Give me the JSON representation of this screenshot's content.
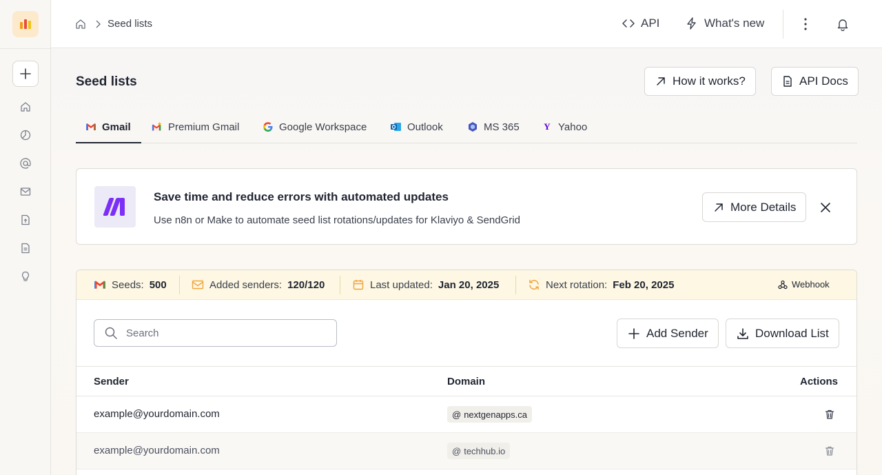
{
  "breadcrumb": {
    "current": "Seed lists"
  },
  "header": {
    "api_label": "API",
    "whats_new_label": "What's new"
  },
  "page": {
    "title": "Seed lists",
    "how_it_works_label": "How it works?",
    "api_docs_label": "API Docs"
  },
  "tabs": [
    {
      "label": "Gmail",
      "icon": "gmail-icon"
    },
    {
      "label": "Premium Gmail",
      "icon": "gmail-icon"
    },
    {
      "label": "Google Workspace",
      "icon": "google-icon"
    },
    {
      "label": "Outlook",
      "icon": "outlook-icon"
    },
    {
      "label": "MS 365",
      "icon": "ms365-icon"
    },
    {
      "label": "Yahoo",
      "icon": "yahoo-icon"
    }
  ],
  "banner": {
    "title": "Save time and reduce errors with automated updates",
    "subtitle": "Use n8n or Make to automate seed list rotations/updates for Klaviyo & SendGrid",
    "button_label": "More Details"
  },
  "stats": {
    "seeds_label": "Seeds:",
    "seeds_value": "500",
    "senders_label": "Added senders:",
    "senders_value": "120/120",
    "updated_label": "Last updated:",
    "updated_value": "Jan 20, 2025",
    "rotation_label": "Next rotation:",
    "rotation_value": "Feb 20, 2025",
    "webhook_label": "Webhook"
  },
  "search": {
    "placeholder": "Search"
  },
  "actions": {
    "add_sender_label": "Add Sender",
    "download_label": "Download List"
  },
  "table": {
    "columns": [
      "Sender",
      "Domain",
      "Actions"
    ],
    "rows": [
      {
        "sender": "example@yourdomain.com",
        "domain": "nextgenapps.ca"
      },
      {
        "sender": "example@yourdomain.com",
        "domain": "techhub.io"
      }
    ]
  },
  "colors": {
    "accent": "#1f2430",
    "banner_logo": "#7b2ff7",
    "stats_bg": "#fdf7e3",
    "stat_icon": "#f0a43a"
  }
}
